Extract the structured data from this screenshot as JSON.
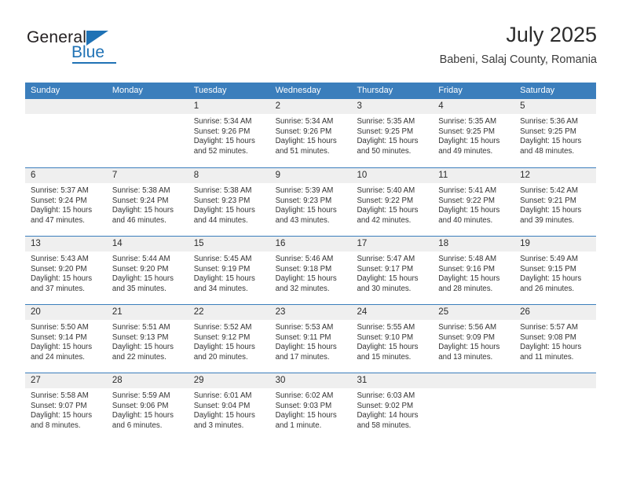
{
  "brand": {
    "name_top": "General",
    "name_bottom": "Blue",
    "accent_color": "#1f72b5"
  },
  "header": {
    "title": "July 2025",
    "subtitle": "Babeni, Salaj County, Romania"
  },
  "theme": {
    "header_blue": "#3b7ebc",
    "day_band_gray": "#efefef",
    "text_color": "#333333"
  },
  "calendar": {
    "weekdays": [
      "Sunday",
      "Monday",
      "Tuesday",
      "Wednesday",
      "Thursday",
      "Friday",
      "Saturday"
    ],
    "weeks": [
      [
        {
          "day": "",
          "lines": []
        },
        {
          "day": "",
          "lines": []
        },
        {
          "day": "1",
          "lines": [
            "Sunrise: 5:34 AM",
            "Sunset: 9:26 PM",
            "Daylight: 15 hours",
            "and 52 minutes."
          ]
        },
        {
          "day": "2",
          "lines": [
            "Sunrise: 5:34 AM",
            "Sunset: 9:26 PM",
            "Daylight: 15 hours",
            "and 51 minutes."
          ]
        },
        {
          "day": "3",
          "lines": [
            "Sunrise: 5:35 AM",
            "Sunset: 9:25 PM",
            "Daylight: 15 hours",
            "and 50 minutes."
          ]
        },
        {
          "day": "4",
          "lines": [
            "Sunrise: 5:35 AM",
            "Sunset: 9:25 PM",
            "Daylight: 15 hours",
            "and 49 minutes."
          ]
        },
        {
          "day": "5",
          "lines": [
            "Sunrise: 5:36 AM",
            "Sunset: 9:25 PM",
            "Daylight: 15 hours",
            "and 48 minutes."
          ]
        }
      ],
      [
        {
          "day": "6",
          "lines": [
            "Sunrise: 5:37 AM",
            "Sunset: 9:24 PM",
            "Daylight: 15 hours",
            "and 47 minutes."
          ]
        },
        {
          "day": "7",
          "lines": [
            "Sunrise: 5:38 AM",
            "Sunset: 9:24 PM",
            "Daylight: 15 hours",
            "and 46 minutes."
          ]
        },
        {
          "day": "8",
          "lines": [
            "Sunrise: 5:38 AM",
            "Sunset: 9:23 PM",
            "Daylight: 15 hours",
            "and 44 minutes."
          ]
        },
        {
          "day": "9",
          "lines": [
            "Sunrise: 5:39 AM",
            "Sunset: 9:23 PM",
            "Daylight: 15 hours",
            "and 43 minutes."
          ]
        },
        {
          "day": "10",
          "lines": [
            "Sunrise: 5:40 AM",
            "Sunset: 9:22 PM",
            "Daylight: 15 hours",
            "and 42 minutes."
          ]
        },
        {
          "day": "11",
          "lines": [
            "Sunrise: 5:41 AM",
            "Sunset: 9:22 PM",
            "Daylight: 15 hours",
            "and 40 minutes."
          ]
        },
        {
          "day": "12",
          "lines": [
            "Sunrise: 5:42 AM",
            "Sunset: 9:21 PM",
            "Daylight: 15 hours",
            "and 39 minutes."
          ]
        }
      ],
      [
        {
          "day": "13",
          "lines": [
            "Sunrise: 5:43 AM",
            "Sunset: 9:20 PM",
            "Daylight: 15 hours",
            "and 37 minutes."
          ]
        },
        {
          "day": "14",
          "lines": [
            "Sunrise: 5:44 AM",
            "Sunset: 9:20 PM",
            "Daylight: 15 hours",
            "and 35 minutes."
          ]
        },
        {
          "day": "15",
          "lines": [
            "Sunrise: 5:45 AM",
            "Sunset: 9:19 PM",
            "Daylight: 15 hours",
            "and 34 minutes."
          ]
        },
        {
          "day": "16",
          "lines": [
            "Sunrise: 5:46 AM",
            "Sunset: 9:18 PM",
            "Daylight: 15 hours",
            "and 32 minutes."
          ]
        },
        {
          "day": "17",
          "lines": [
            "Sunrise: 5:47 AM",
            "Sunset: 9:17 PM",
            "Daylight: 15 hours",
            "and 30 minutes."
          ]
        },
        {
          "day": "18",
          "lines": [
            "Sunrise: 5:48 AM",
            "Sunset: 9:16 PM",
            "Daylight: 15 hours",
            "and 28 minutes."
          ]
        },
        {
          "day": "19",
          "lines": [
            "Sunrise: 5:49 AM",
            "Sunset: 9:15 PM",
            "Daylight: 15 hours",
            "and 26 minutes."
          ]
        }
      ],
      [
        {
          "day": "20",
          "lines": [
            "Sunrise: 5:50 AM",
            "Sunset: 9:14 PM",
            "Daylight: 15 hours",
            "and 24 minutes."
          ]
        },
        {
          "day": "21",
          "lines": [
            "Sunrise: 5:51 AM",
            "Sunset: 9:13 PM",
            "Daylight: 15 hours",
            "and 22 minutes."
          ]
        },
        {
          "day": "22",
          "lines": [
            "Sunrise: 5:52 AM",
            "Sunset: 9:12 PM",
            "Daylight: 15 hours",
            "and 20 minutes."
          ]
        },
        {
          "day": "23",
          "lines": [
            "Sunrise: 5:53 AM",
            "Sunset: 9:11 PM",
            "Daylight: 15 hours",
            "and 17 minutes."
          ]
        },
        {
          "day": "24",
          "lines": [
            "Sunrise: 5:55 AM",
            "Sunset: 9:10 PM",
            "Daylight: 15 hours",
            "and 15 minutes."
          ]
        },
        {
          "day": "25",
          "lines": [
            "Sunrise: 5:56 AM",
            "Sunset: 9:09 PM",
            "Daylight: 15 hours",
            "and 13 minutes."
          ]
        },
        {
          "day": "26",
          "lines": [
            "Sunrise: 5:57 AM",
            "Sunset: 9:08 PM",
            "Daylight: 15 hours",
            "and 11 minutes."
          ]
        }
      ],
      [
        {
          "day": "27",
          "lines": [
            "Sunrise: 5:58 AM",
            "Sunset: 9:07 PM",
            "Daylight: 15 hours",
            "and 8 minutes."
          ]
        },
        {
          "day": "28",
          "lines": [
            "Sunrise: 5:59 AM",
            "Sunset: 9:06 PM",
            "Daylight: 15 hours",
            "and 6 minutes."
          ]
        },
        {
          "day": "29",
          "lines": [
            "Sunrise: 6:01 AM",
            "Sunset: 9:04 PM",
            "Daylight: 15 hours",
            "and 3 minutes."
          ]
        },
        {
          "day": "30",
          "lines": [
            "Sunrise: 6:02 AM",
            "Sunset: 9:03 PM",
            "Daylight: 15 hours",
            "and 1 minute."
          ]
        },
        {
          "day": "31",
          "lines": [
            "Sunrise: 6:03 AM",
            "Sunset: 9:02 PM",
            "Daylight: 14 hours",
            "and 58 minutes."
          ]
        },
        {
          "day": "",
          "lines": []
        },
        {
          "day": "",
          "lines": []
        }
      ]
    ]
  }
}
